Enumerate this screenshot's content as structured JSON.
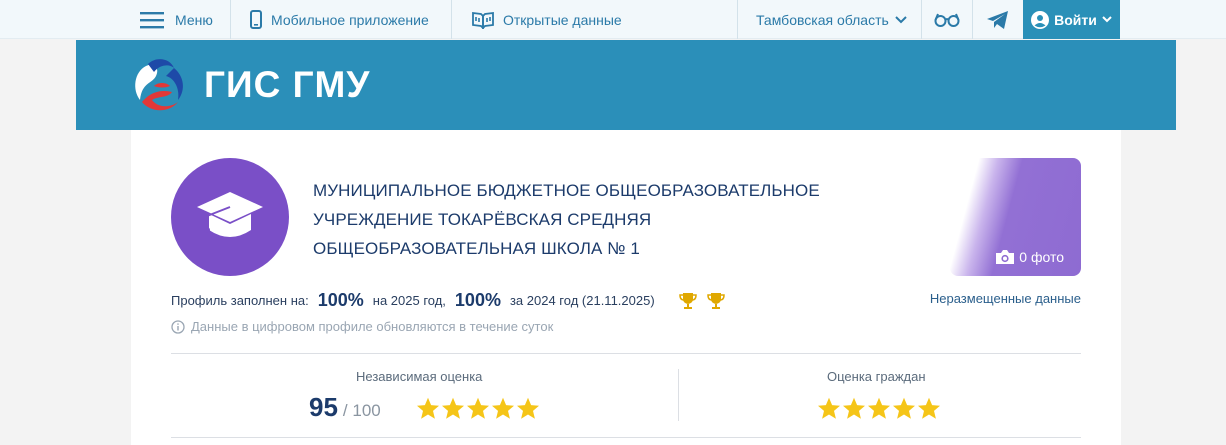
{
  "topbar": {
    "menu_label": "Меню",
    "mobile_label": "Мобильное приложение",
    "open_data_label": "Открытые данные",
    "region_label": "Тамбовская область",
    "login_label": "Войти"
  },
  "banner": {
    "brand": "ГИС ГМУ"
  },
  "org": {
    "title": "МУНИЦИПАЛЬНОЕ БЮДЖЕТНОЕ ОБЩЕОБРАЗОВАТЕЛЬНОЕ УЧРЕЖДЕНИЕ ТОКАРЁВСКАЯ СРЕДНЯЯ ОБЩЕОБРАЗОВАТЕЛЬНАЯ ШКОЛА № 1",
    "photo_count": "0 фото"
  },
  "profile": {
    "filled_label": "Профиль заполнен на:",
    "pct_2025": "100%",
    "year_2025": "на 2025 год,",
    "pct_2024": "100%",
    "year_2024": "за 2024 год (21.11.2025)",
    "unplaced_label": "Неразмещенные данные",
    "notice": "Данные в цифровом профиле обновляются в течение суток"
  },
  "ratings": {
    "independent_label": "Независимая оценка",
    "independent_score": "95",
    "independent_max": "/ 100",
    "independent_stars": 5,
    "citizens_label": "Оценка граждан",
    "citizens_stars": 5
  },
  "colors": {
    "banner": "#2b8fb9",
    "accent_purple": "#7a4fc7",
    "star": "#f5c518",
    "login_bg": "#2a90b8"
  }
}
